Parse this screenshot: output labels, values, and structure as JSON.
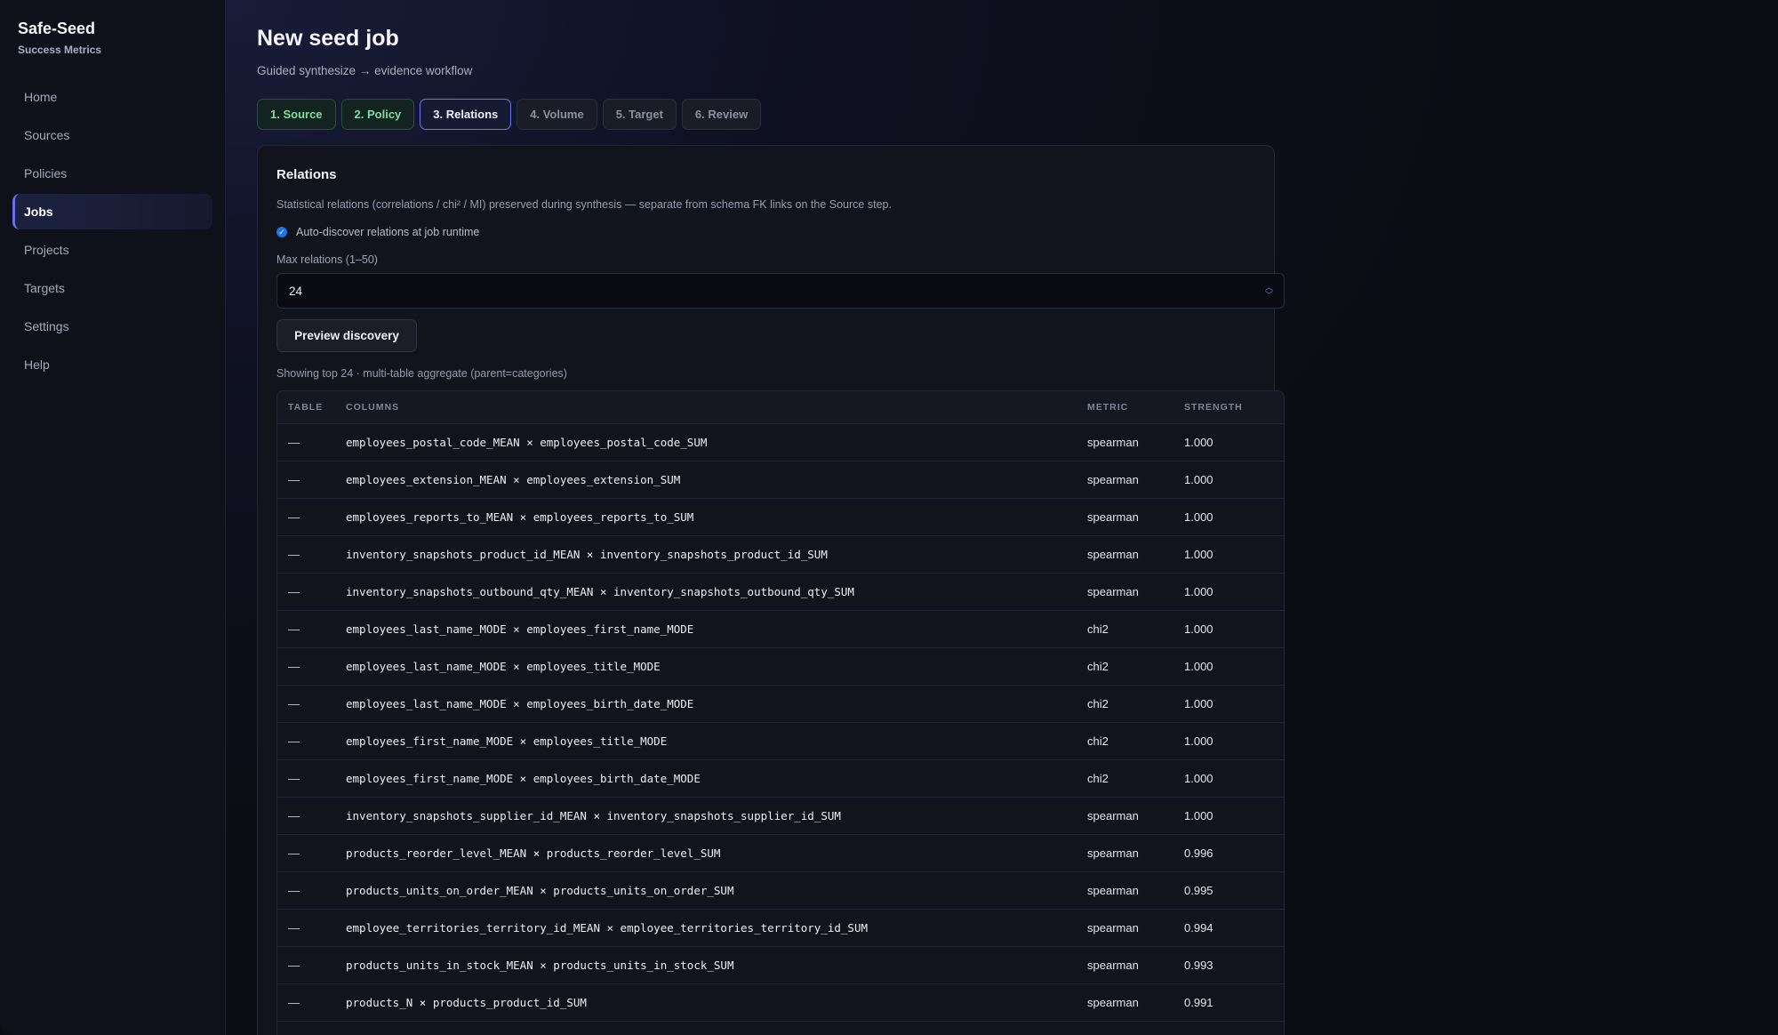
{
  "sidebar": {
    "brand": "Safe-Seed",
    "subtitle": "Success Metrics",
    "items": [
      {
        "label": "Home"
      },
      {
        "label": "Sources"
      },
      {
        "label": "Policies"
      },
      {
        "label": "Jobs",
        "active": true
      },
      {
        "label": "Projects"
      },
      {
        "label": "Targets"
      },
      {
        "label": "Settings"
      },
      {
        "label": "Help"
      }
    ]
  },
  "header": {
    "title": "New seed job",
    "subtitle": "Guided synthesize → evidence workflow"
  },
  "steps": [
    {
      "label": "1. Source",
      "state": "done"
    },
    {
      "label": "2. Policy",
      "state": "done"
    },
    {
      "label": "3. Relations",
      "state": "current"
    },
    {
      "label": "4. Volume",
      "state": "pending"
    },
    {
      "label": "5. Target",
      "state": "pending"
    },
    {
      "label": "6. Review",
      "state": "pending"
    }
  ],
  "relations": {
    "title": "Relations",
    "description": "Statistical relations (correlations / chi² / MI) preserved during synthesis — separate from schema FK links on the Source step.",
    "auto_discover_label": "Auto-discover relations at job runtime",
    "auto_discover_checked": true,
    "max_label": "Max relations (1–50)",
    "max_value": "24",
    "preview_button": "Preview discovery",
    "showing": "Showing top 24 · multi-table aggregate (parent=categories)"
  },
  "table": {
    "headers": {
      "table": "TABLE",
      "columns": "COLUMNS",
      "metric": "METRIC",
      "strength": "STRENGTH"
    },
    "rows": [
      {
        "table": "—",
        "columns": "employees_postal_code_MEAN × employees_postal_code_SUM",
        "metric": "spearman",
        "strength": "1.000"
      },
      {
        "table": "—",
        "columns": "employees_extension_MEAN × employees_extension_SUM",
        "metric": "spearman",
        "strength": "1.000"
      },
      {
        "table": "—",
        "columns": "employees_reports_to_MEAN × employees_reports_to_SUM",
        "metric": "spearman",
        "strength": "1.000"
      },
      {
        "table": "—",
        "columns": "inventory_snapshots_product_id_MEAN × inventory_snapshots_product_id_SUM",
        "metric": "spearman",
        "strength": "1.000"
      },
      {
        "table": "—",
        "columns": "inventory_snapshots_outbound_qty_MEAN × inventory_snapshots_outbound_qty_SUM",
        "metric": "spearman",
        "strength": "1.000"
      },
      {
        "table": "—",
        "columns": "employees_last_name_MODE × employees_first_name_MODE",
        "metric": "chi2",
        "strength": "1.000"
      },
      {
        "table": "—",
        "columns": "employees_last_name_MODE × employees_title_MODE",
        "metric": "chi2",
        "strength": "1.000"
      },
      {
        "table": "—",
        "columns": "employees_last_name_MODE × employees_birth_date_MODE",
        "metric": "chi2",
        "strength": "1.000"
      },
      {
        "table": "—",
        "columns": "employees_first_name_MODE × employees_title_MODE",
        "metric": "chi2",
        "strength": "1.000"
      },
      {
        "table": "—",
        "columns": "employees_first_name_MODE × employees_birth_date_MODE",
        "metric": "chi2",
        "strength": "1.000"
      },
      {
        "table": "—",
        "columns": "inventory_snapshots_supplier_id_MEAN × inventory_snapshots_supplier_id_SUM",
        "metric": "spearman",
        "strength": "1.000"
      },
      {
        "table": "—",
        "columns": "products_reorder_level_MEAN × products_reorder_level_SUM",
        "metric": "spearman",
        "strength": "0.996"
      },
      {
        "table": "—",
        "columns": "products_units_on_order_MEAN × products_units_on_order_SUM",
        "metric": "spearman",
        "strength": "0.995"
      },
      {
        "table": "—",
        "columns": "employee_territories_territory_id_MEAN × employee_territories_territory_id_SUM",
        "metric": "spearman",
        "strength": "0.994"
      },
      {
        "table": "—",
        "columns": "products_units_in_stock_MEAN × products_units_in_stock_SUM",
        "metric": "spearman",
        "strength": "0.993"
      },
      {
        "table": "—",
        "columns": "products_N × products_product_id_SUM",
        "metric": "spearman",
        "strength": "0.991"
      }
    ]
  }
}
